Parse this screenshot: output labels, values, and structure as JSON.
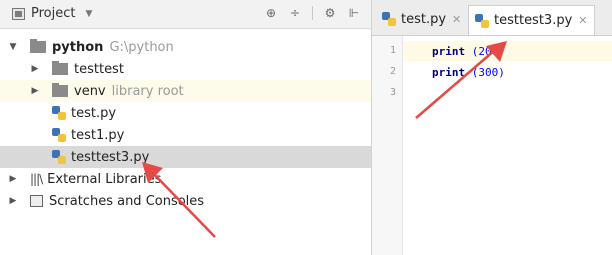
{
  "project_panel": {
    "title": "Project",
    "tools": [
      "⊕",
      "÷",
      "⚙",
      "⊩"
    ],
    "tree": {
      "root": {
        "name": "python",
        "path": "G:\\python"
      },
      "items": [
        {
          "label": "testtest"
        },
        {
          "label": "venv",
          "note": "library root"
        },
        {
          "label": "test.py"
        },
        {
          "label": "test1.py"
        },
        {
          "label": "testtest3.py"
        }
      ],
      "external_libraries": "External Libraries",
      "scratches": "Scratches and Consoles"
    }
  },
  "editor": {
    "tabs": [
      {
        "label": "test.py"
      },
      {
        "label": "testtest3.py"
      }
    ],
    "line_numbers": [
      "1",
      "2",
      "3"
    ],
    "code": [
      {
        "kw": "print",
        "arg": " (200)"
      },
      {
        "kw": "print",
        "arg": " (300)"
      }
    ]
  },
  "colors": {
    "annotation_arrow": "#e64a47",
    "selection": "#d9d9d9",
    "library_root_bg": "#fdfbe9",
    "current_line_bg": "#fffae3"
  }
}
